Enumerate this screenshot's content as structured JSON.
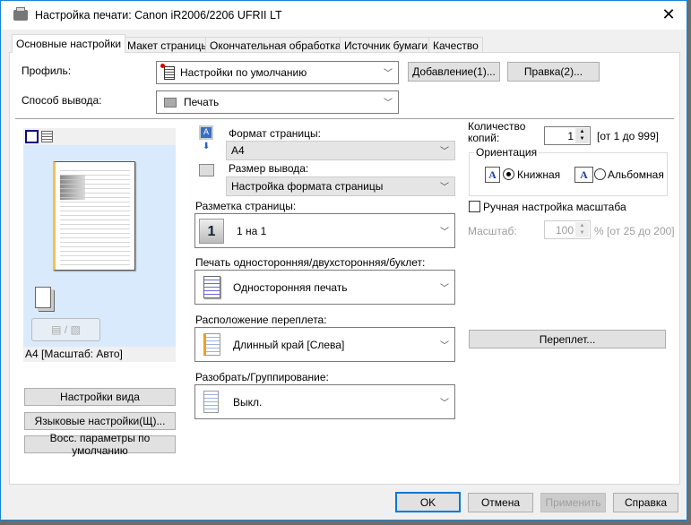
{
  "window": {
    "title": "Настройка печати: Canon iR2006/2206 UFRII LT",
    "close": "✕"
  },
  "tabs": [
    "Основные настройки",
    "Макет страницы",
    "Окончательная обработка",
    "Источник бумаги",
    "Качество"
  ],
  "profile": {
    "label": "Профиль:",
    "value": "Настройки по умолчанию",
    "add": "Добавление(1)...",
    "edit": "Правка(2)..."
  },
  "output": {
    "label": "Способ вывода:",
    "value": "Печать"
  },
  "preview": {
    "status": "A4 [Масштаб: Авто]"
  },
  "left_buttons": {
    "view": "Настройки вида",
    "language": "Языковые настройки(Щ)...",
    "restore": "Восс. параметры по умолчанию"
  },
  "page_size": {
    "label": "Формат страницы:",
    "value": "A4"
  },
  "output_size": {
    "label": "Размер вывода:",
    "value": "Настройка формата страницы"
  },
  "layout": {
    "label": "Разметка страницы:",
    "value": "1 на 1",
    "icon_text": "1"
  },
  "duplex": {
    "label": "Печать односторонняя/двухсторонняя/буклет:",
    "value": "Односторонняя печать"
  },
  "binding": {
    "label": "Расположение переплета:",
    "value": "Длинный край [Слева]",
    "button": "Переплет..."
  },
  "collate": {
    "label": "Разобрать/Группирование:",
    "value": "Выкл."
  },
  "copies": {
    "label_line1": "Количество",
    "label_line2": "копий:",
    "value": "1",
    "range": "[от 1 до 999]"
  },
  "orientation": {
    "label": "Ориентация",
    "portrait": "Книжная",
    "landscape": "Альбомная",
    "selected": "portrait"
  },
  "manual_scale": {
    "label": "Ручная настройка масштаба",
    "checked": false
  },
  "scale": {
    "label": "Масштаб:",
    "value": "100",
    "range": "% [от 25 до 200]"
  },
  "footer": {
    "ok": "OK",
    "cancel": "Отмена",
    "apply": "Применить",
    "help": "Справка"
  }
}
